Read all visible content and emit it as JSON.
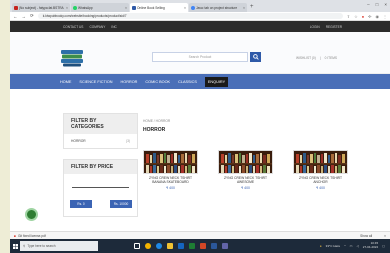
{
  "browser": {
    "tabs": [
      {
        "label": "(No subject) - fatypa.fat.BSTRA",
        "active": false
      },
      {
        "label": "WhatsApp",
        "active": false
      },
      {
        "label": "Online Book Selling",
        "active": true
      },
      {
        "label": "Java: tab on project structure",
        "active": false
      }
    ],
    "url": "k.ktwpubbooky.com/website/booking/products/product/sid/7"
  },
  "site": {
    "top_links_left": [
      "CONTACT US",
      "COMPANY",
      "INC"
    ],
    "top_links_right": [
      "LOGIN",
      "REGISTER"
    ],
    "search_placeholder": "Search Product",
    "header_links": [
      "WISHLIST (0)",
      "0 ITEMS"
    ],
    "categories": [
      {
        "label": "HOME",
        "active": false
      },
      {
        "label": "SCIENCE FICTION",
        "active": false
      },
      {
        "label": "HORROR",
        "active": false
      },
      {
        "label": "COMIC BOOK",
        "active": false
      },
      {
        "label": "CLASSICS",
        "active": false
      },
      {
        "label": "ENQUIRY",
        "active": true
      }
    ]
  },
  "sidebar": {
    "categories_title": "FILTER BY CATEGORIES",
    "category_item": {
      "label": "HORROR",
      "count": "(3)"
    },
    "price_title": "FILTER BY PRICE",
    "price_min": "Rs. 0",
    "price_max": "Rs. 10000"
  },
  "main": {
    "breadcrumb": "HOME / HORROR",
    "heading": "HORROR",
    "products": [
      {
        "name": "ZYNG CREW NECK TSHIRT BANANA SKATEBOARD",
        "price": "₹ 400"
      },
      {
        "name": "ZYNG CREW NECK TSHIRT AWESOME",
        "price": "₹ 400"
      },
      {
        "name": "ZYNG CREW NECK TSHIRT ANCHOR",
        "price": "₹ 400"
      }
    ]
  },
  "download_bar": {
    "file": "Git fixed license.pdf",
    "show_all": "Show all"
  },
  "taskbar": {
    "search_placeholder": "Type here to search",
    "weather": "33°C Haze",
    "time": "10:45",
    "date": "27-04-2022"
  }
}
